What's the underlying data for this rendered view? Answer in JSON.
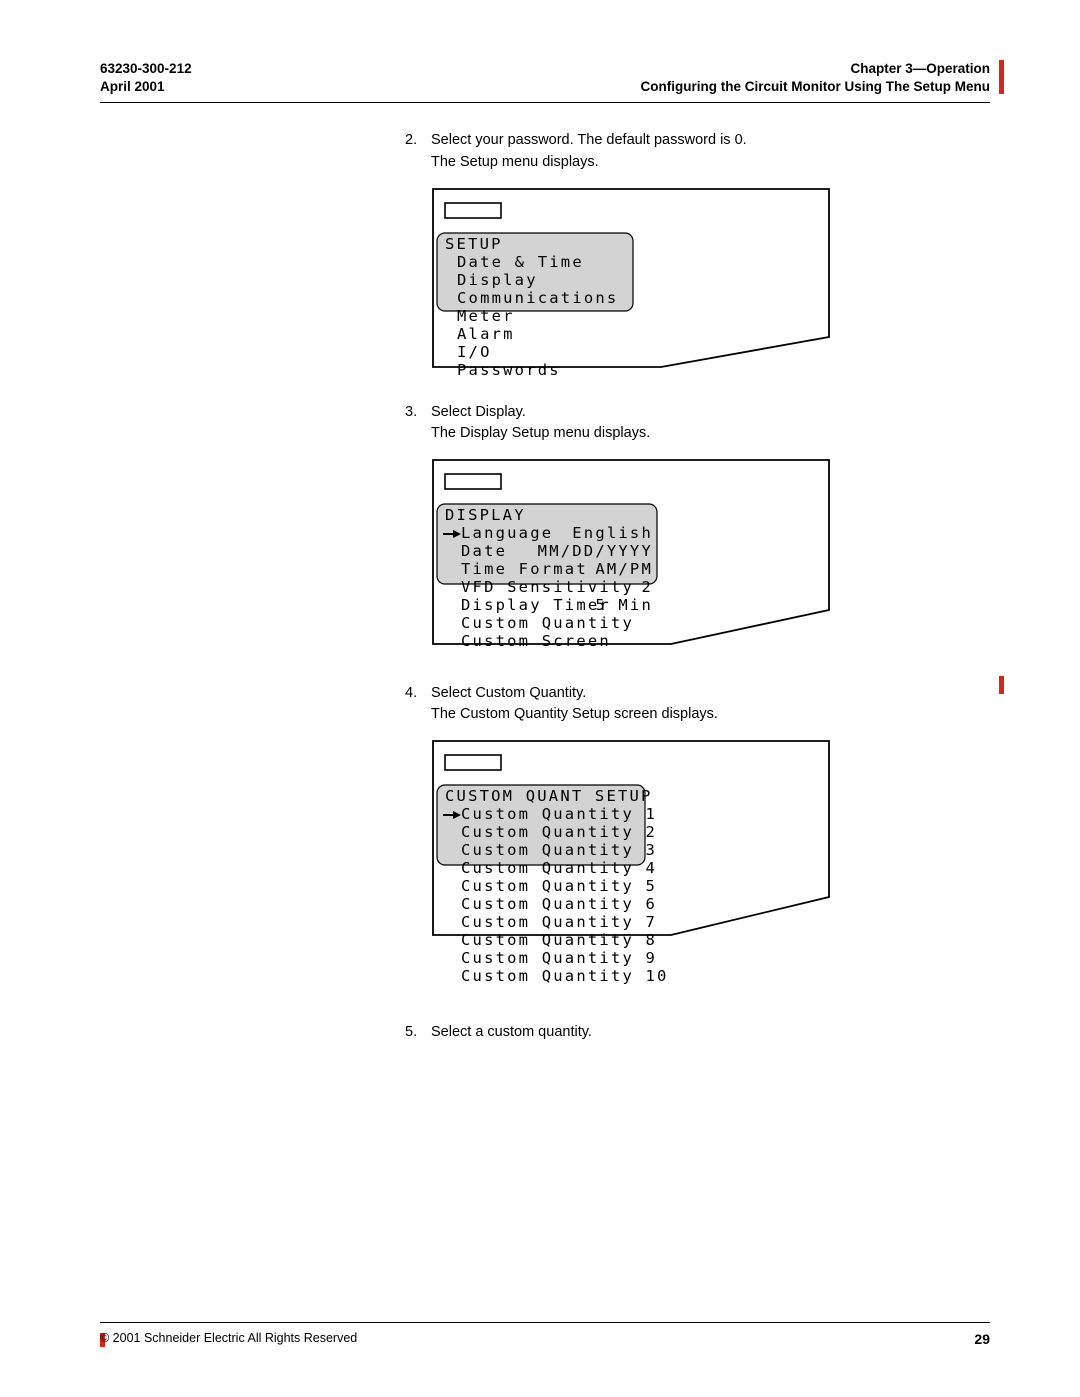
{
  "header": {
    "doc_number": "63230-300-212",
    "date": "April 2001",
    "chapter": "Chapter 3—Operation",
    "section": "Configuring the Circuit Monitor Using The Setup Menu"
  },
  "steps": {
    "s2num": "2.",
    "s2a": "Select your password. The default password is 0.",
    "s2b": "The Setup menu displays.",
    "s3num": "3.",
    "s3a": "Select Display.",
    "s3b": "The Display Setup menu displays.",
    "s4num": "4.",
    "s4a": "Select Custom Quantity.",
    "s4b": "The Custom Quantity Setup screen displays.",
    "s5num": "5.",
    "s5a": "Select a custom quantity."
  },
  "lcd_setup": {
    "title": "SETUP",
    "items": [
      "Date & Time",
      "Display",
      "Communications",
      "Meter",
      "Alarm",
      "I/O",
      "Passwords"
    ]
  },
  "lcd_display": {
    "title": "DISPLAY",
    "rows": [
      {
        "label": "Language",
        "value": "English",
        "arrow": true
      },
      {
        "label": "Date",
        "value": "MM/DD/YYYY"
      },
      {
        "label": "Time Format",
        "value": "AM/PM"
      },
      {
        "label": "VFD Sensitivity",
        "value": "2"
      },
      {
        "label": "Display Timer",
        "value": "5 Min"
      },
      {
        "label": "Custom Quantity",
        "value": ""
      },
      {
        "label": "Custom Screen",
        "value": ""
      }
    ]
  },
  "lcd_custom": {
    "title": "CUSTOM QUANT SETUP",
    "items": [
      "Custom Quantity 1",
      "Custom Quantity 2",
      "Custom Quantity 3",
      "Custom Quantity 4",
      "Custom Quantity 5",
      "Custom Quantity 6",
      "Custom Quantity 7",
      "Custom Quantity 8",
      "Custom Quantity 9",
      "Custom Quantity 10"
    ]
  },
  "footer": {
    "copyright": "© 2001 Schneider Electric  All Rights Reserved",
    "page": "29"
  }
}
